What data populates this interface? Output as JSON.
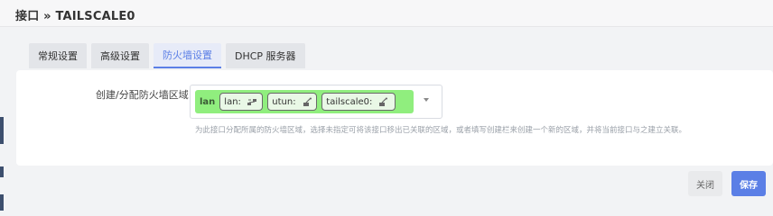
{
  "page": {
    "title": "接口 » TAILSCALE0"
  },
  "tabs": [
    {
      "label": "常规设置",
      "active": false
    },
    {
      "label": "高级设置",
      "active": false
    },
    {
      "label": "防火墙设置",
      "active": true
    },
    {
      "label": "DHCP 服务器",
      "active": false
    }
  ],
  "firewall": {
    "zone_label": "创建/分配防火墙区域",
    "selected_zone": "lan",
    "zone_color": "#90ee7e",
    "interfaces": [
      {
        "name": "lan:",
        "icon": "bridge-icon"
      },
      {
        "name": "utun:",
        "icon": "ethernet-port-icon"
      },
      {
        "name": "tailscale0:",
        "icon": "ethernet-port-icon"
      }
    ],
    "help_text": "为此接口分配所属的防火墙区域，选择未指定可将该接口移出已关联的区域，或者填写创建栏来创建一个新的区域，并将当前接口与之建立关联。"
  },
  "actions": {
    "close_label": "关闭",
    "save_label": "保存"
  },
  "colors": {
    "accent": "#5b7fe6",
    "zone_green": "#90ee7e"
  }
}
